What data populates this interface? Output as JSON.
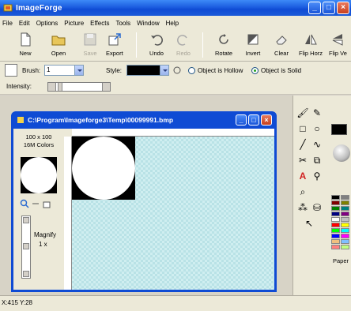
{
  "app": {
    "title": "ImageForge"
  },
  "menu": [
    {
      "label": "File"
    },
    {
      "label": "Edit"
    },
    {
      "label": "Options"
    },
    {
      "label": "Picture"
    },
    {
      "label": "Effects"
    },
    {
      "label": "Tools"
    },
    {
      "label": "Window"
    },
    {
      "label": "Help"
    }
  ],
  "toolbar": {
    "new": "New",
    "open": "Open",
    "save": "Save",
    "export": "Export",
    "undo": "Undo",
    "redo": "Redo",
    "rotate": "Rotate",
    "invert": "Invert",
    "clear": "Clear",
    "flip_horz": "Flip Horz",
    "flip_vert": "Flip Ve"
  },
  "options": {
    "brush_label": "Brush:",
    "brush_value": "1",
    "style_label": "Style:",
    "style_color": "#000000",
    "hollow_label": "Object is Hollow",
    "solid_label": "Object is Solid",
    "solid_selected": true,
    "intensity_label": "Intensity:"
  },
  "document": {
    "title": "C:\\Program\\Imageforge3\\Temp\\00099991.bmp",
    "size": "100 x 100",
    "colors": "16M Colors",
    "magnify_label": "Magnify",
    "magnify_value": "1 x"
  },
  "tools": {
    "paper_label": "Paper"
  },
  "palette": [
    "#000000",
    "#808080",
    "#800000",
    "#808000",
    "#008000",
    "#008080",
    "#000080",
    "#800080",
    "#ffffff",
    "#c0c0c0",
    "#ff0000",
    "#ffff00",
    "#00ff00",
    "#00ffff",
    "#0000ff",
    "#ff00ff",
    "#f0c080",
    "#80c0ff",
    "#ff8080",
    "#c0ff80"
  ],
  "status": {
    "coords": "X:415 Y:28"
  }
}
